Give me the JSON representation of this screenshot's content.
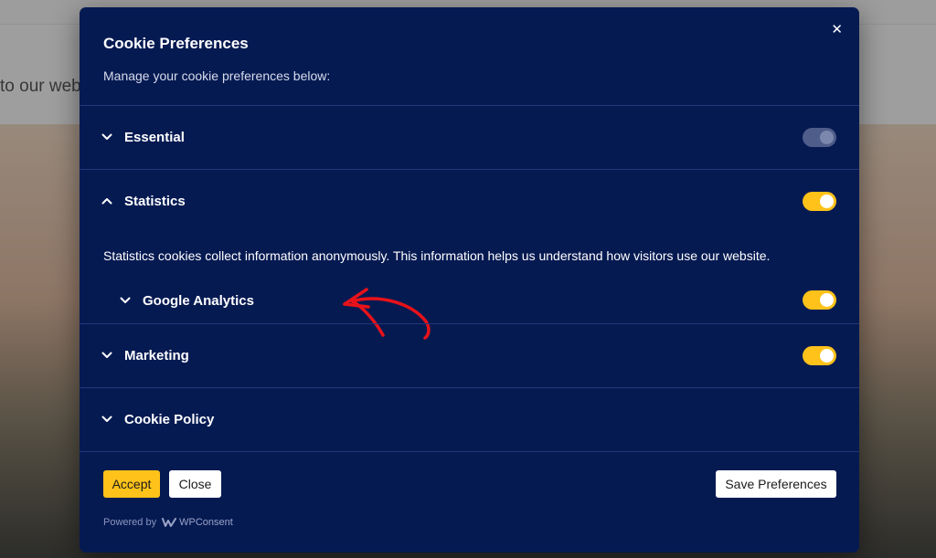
{
  "background": {
    "welcome_text": "to our web"
  },
  "modal": {
    "title": "Cookie Preferences",
    "subtitle": "Manage your cookie preferences below:",
    "close_icon": "close-icon"
  },
  "categories": [
    {
      "label": "Essential",
      "expanded": false,
      "enabled": true,
      "locked": true
    },
    {
      "label": "Statistics",
      "expanded": true,
      "enabled": true,
      "locked": false,
      "description": "Statistics cookies collect information anonymously. This information helps us understand how visitors use our website.",
      "services": [
        {
          "label": "Google Analytics",
          "enabled": true
        }
      ]
    },
    {
      "label": "Marketing",
      "expanded": false,
      "enabled": true,
      "locked": false
    },
    {
      "label": "Cookie Policy",
      "expanded": false
    }
  ],
  "buttons": {
    "accept": "Accept",
    "close": "Close",
    "save": "Save Preferences"
  },
  "footer": {
    "powered_by": "Powered by",
    "brand": "WPConsent"
  },
  "colors": {
    "modal_bg": "#061a52",
    "accent": "#ffc21a",
    "annotation": "#e8121a"
  }
}
